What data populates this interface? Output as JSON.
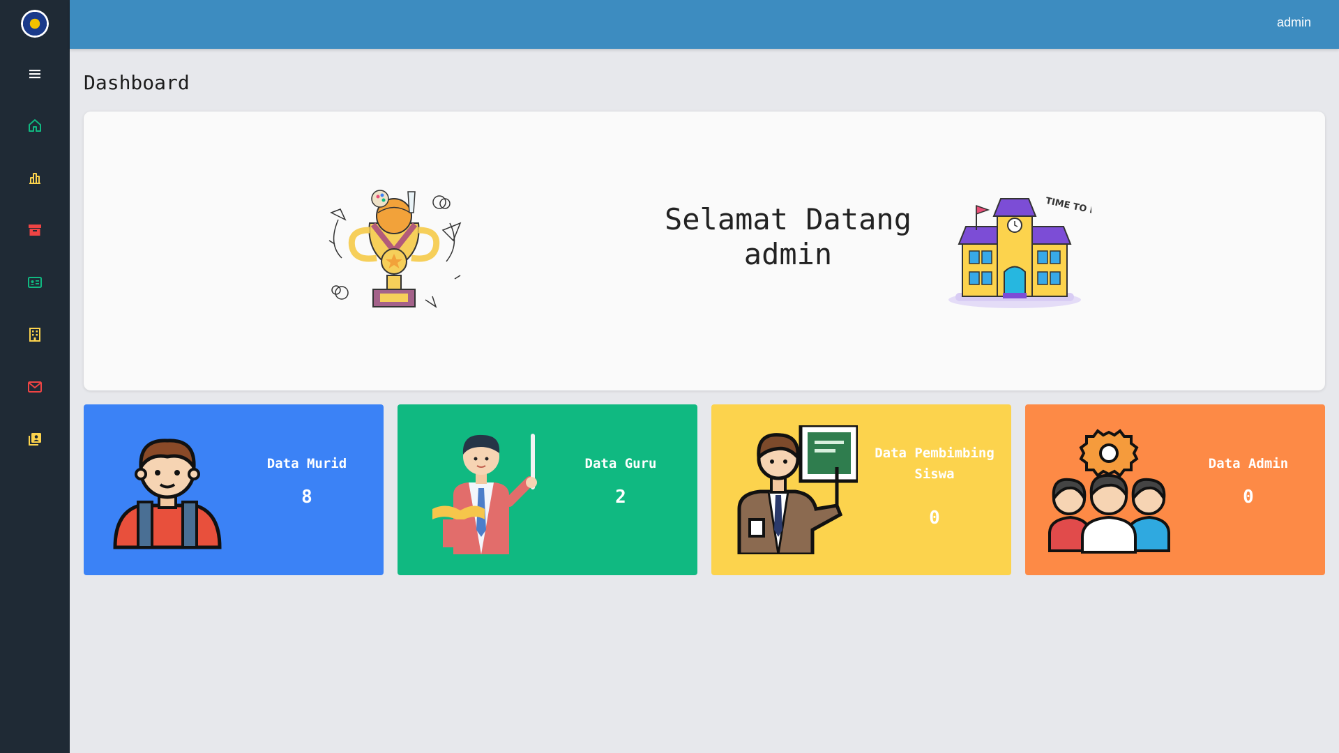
{
  "topbar": {
    "user": "admin"
  },
  "sidebar": {
    "items": [
      {
        "icon": "menu-icon",
        "color": "#ffffff"
      },
      {
        "icon": "home-icon",
        "color": "#10b981"
      },
      {
        "icon": "chart-icon",
        "color": "#fcd34d"
      },
      {
        "icon": "archive-icon",
        "color": "#ef4444"
      },
      {
        "icon": "id-card-icon",
        "color": "#10b981"
      },
      {
        "icon": "building-icon",
        "color": "#fcd34d"
      },
      {
        "icon": "mail-icon",
        "color": "#ef4444"
      },
      {
        "icon": "contact-icon",
        "color": "#fcd34d"
      }
    ]
  },
  "page": {
    "title": "Dashboard"
  },
  "welcome": {
    "line1": "Selamat Datang",
    "line2": "admin"
  },
  "cards": [
    {
      "label": "Data Murid",
      "value": "8",
      "color": "#3b82f6"
    },
    {
      "label": "Data Guru",
      "value": "2",
      "color": "#10b981"
    },
    {
      "label": "Data Pembimbing Siswa",
      "value": "0",
      "color": "#fcd34d"
    },
    {
      "label": "Data Admin",
      "value": "0",
      "color": "#fd8a46"
    }
  ],
  "school_badge": {
    "text": "TIME TO LEARN!"
  }
}
